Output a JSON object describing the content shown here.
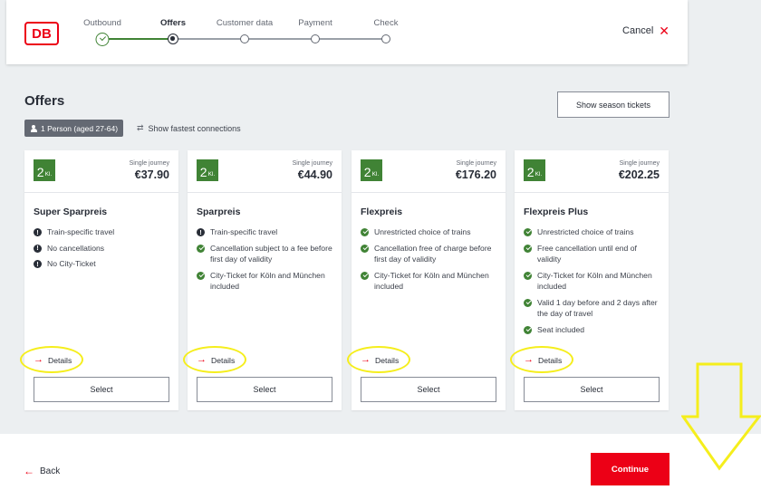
{
  "header": {
    "logo_text": "DB",
    "steps": [
      {
        "label": "Outbound",
        "state": "done"
      },
      {
        "label": "Offers",
        "state": "current"
      },
      {
        "label": "Customer data",
        "state": "todo"
      },
      {
        "label": "Payment",
        "state": "todo"
      },
      {
        "label": "Check",
        "state": "todo"
      }
    ],
    "cancel_label": "Cancel"
  },
  "offers": {
    "title": "Offers",
    "season_button": "Show season tickets",
    "passengers": "1 Person (aged 27-64)",
    "fastest_label": "Show fastest connections"
  },
  "cards": [
    {
      "class_num": "2",
      "class_suffix": "Kl.",
      "journey": "Single journey",
      "price": "€37.90",
      "name": "Super Sparpreis",
      "features": [
        {
          "text": "Train-specific travel",
          "type": "bad"
        },
        {
          "text": "No cancellations",
          "type": "bad"
        },
        {
          "text": "No City-Ticket",
          "type": "bad"
        }
      ],
      "details_label": "Details",
      "select_label": "Select"
    },
    {
      "class_num": "2",
      "class_suffix": "Kl.",
      "journey": "Single journey",
      "price": "€44.90",
      "name": "Sparpreis",
      "features": [
        {
          "text": "Train-specific travel",
          "type": "bad"
        },
        {
          "text": "Cancellation subject to a fee before first day of validity",
          "type": "good"
        },
        {
          "text": "City-Ticket for Köln and München included",
          "type": "good"
        }
      ],
      "details_label": "Details",
      "select_label": "Select"
    },
    {
      "class_num": "2",
      "class_suffix": "Kl.",
      "journey": "Single journey",
      "price": "€176.20",
      "name": "Flexpreis",
      "features": [
        {
          "text": "Unrestricted choice of trains",
          "type": "good"
        },
        {
          "text": "Cancellation free of charge before first day of validity",
          "type": "good"
        },
        {
          "text": "City-Ticket for Köln and München included",
          "type": "good"
        }
      ],
      "details_label": "Details",
      "select_label": "Select"
    },
    {
      "class_num": "2",
      "class_suffix": "Kl.",
      "journey": "Single journey",
      "price": "€202.25",
      "name": "Flexpreis Plus",
      "features": [
        {
          "text": "Unrestricted choice of trains",
          "type": "good"
        },
        {
          "text": "Free cancellation until end of validity",
          "type": "good"
        },
        {
          "text": "City-Ticket for Köln and München included",
          "type": "good"
        },
        {
          "text": "Valid 1 day before and 2 days after the day of travel",
          "type": "good"
        },
        {
          "text": "Seat included",
          "type": "good"
        }
      ],
      "details_label": "Details",
      "select_label": "Select"
    }
  ],
  "footer": {
    "back_label": "Back",
    "continue_label": "Continue"
  },
  "colors": {
    "brand_red": "#ec0016",
    "class_green": "#408335",
    "highlight_yellow": "#f5ee1c"
  }
}
